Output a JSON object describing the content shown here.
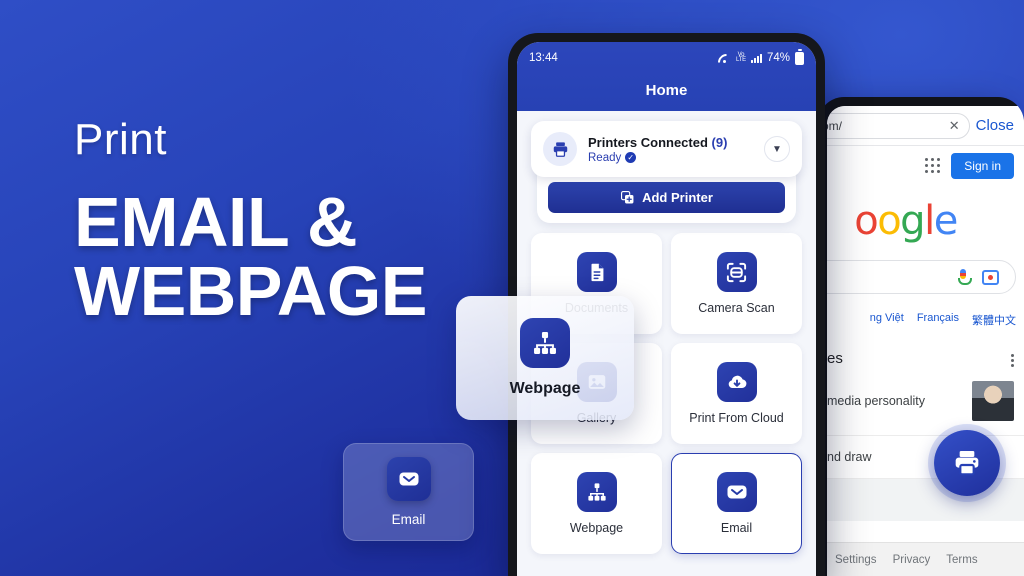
{
  "theme": {
    "bg_top": "#2f4ec6",
    "bg_bottom": "#15208a",
    "accent": "#2a3eb0",
    "google_blue": "#1a73e8"
  },
  "marketing": {
    "kicker": "Print",
    "headline_line1": "EMAIL &",
    "headline_line2": "WEBPAGE"
  },
  "floating_email_card": {
    "label": "Email",
    "icon": "email-icon"
  },
  "floating_webpage_card": {
    "label": "Webpage",
    "icon": "sitemap-icon"
  },
  "phone_main": {
    "statusbar": {
      "time": "13:44",
      "wifi_icon": "wifi-icon",
      "vowifi_label": "VoWiFi",
      "signal_icon": "signal-icon",
      "battery_percent": "74%",
      "battery_icon": "battery-icon"
    },
    "title": "Home",
    "printer_card": {
      "icon": "printer-icon",
      "name": "Printers Connected",
      "count": "(9)",
      "status": "Ready",
      "status_badge": "check-icon",
      "expand_icon": "chevron-down-icon"
    },
    "add_printer": {
      "label": "Add Printer",
      "icon": "add-square-icon"
    },
    "tiles": [
      {
        "label": "Documents",
        "icon": "document-icon",
        "selected": false
      },
      {
        "label": "Camera Scan",
        "icon": "camera-scan-icon",
        "selected": false
      },
      {
        "label": "Gallery",
        "icon": "gallery-icon",
        "selected": false
      },
      {
        "label": "Print From Cloud",
        "icon": "cloud-download-icon",
        "selected": false
      },
      {
        "label": "Webpage",
        "icon": "sitemap-icon",
        "selected": false
      },
      {
        "label": "Email",
        "icon": "email-icon",
        "selected": true
      }
    ]
  },
  "phone_browser": {
    "url_value": "com/",
    "clear_icon": "close-icon",
    "close_label": "Close",
    "apps_icon": "apps-grid-icon",
    "signin_label": "Sign in",
    "logo_text": "oogle",
    "search_mic_icon": "microphone-icon",
    "search_lens_icon": "google-lens-icon",
    "languages": [
      "ng Việt",
      "Français",
      "繁體中文"
    ],
    "news_heading": "es",
    "news_menu_icon": "kebab-menu-icon",
    "news_items": [
      {
        "text": "media personality",
        "has_thumb": true
      },
      {
        "text": "nd draw",
        "has_thumb": false
      }
    ],
    "print_fab_icon": "printer-icon",
    "footer_links": [
      "Settings",
      "Privacy",
      "Terms"
    ]
  }
}
